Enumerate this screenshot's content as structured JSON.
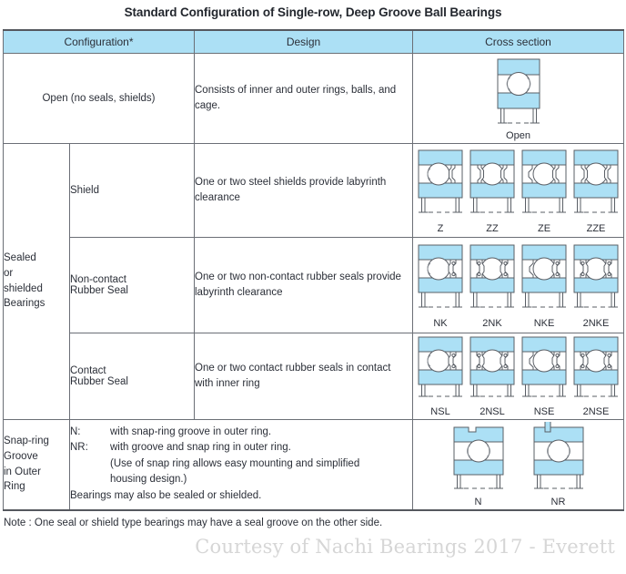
{
  "title": "Standard Configuration of Single-row, Deep Groove Ball Bearings",
  "colors": {
    "ring_blue": "#ace0f5",
    "header_blue": "#ace0f5",
    "line": "#6b6f76",
    "text": "#2b2f38",
    "watermark": "#d6d6d6"
  },
  "header": {
    "configuration": "Configuration*",
    "design": "Design",
    "cross_section": "Cross section"
  },
  "rows": {
    "open": {
      "configuration": "Open (no seals, shields)",
      "design": "Consists of inner and outer rings, balls, and cage.",
      "diagrams": [
        {
          "label": "Open",
          "type": "open"
        }
      ]
    },
    "group_label": "Sealed\nor\nshielded\nBearings",
    "group_label_lines": [
      "Sealed",
      "or",
      "shielded",
      "Bearings"
    ],
    "shield": {
      "subtype": "Shield",
      "design": "One or two steel shields provide labyrinth clearance",
      "diagrams": [
        {
          "label": "Z",
          "type": "shield",
          "sides": "right"
        },
        {
          "label": "ZZ",
          "type": "shield",
          "sides": "both"
        },
        {
          "label": "ZE",
          "type": "shield-e",
          "sides": "right"
        },
        {
          "label": "ZZE",
          "type": "shield-e",
          "sides": "both"
        }
      ]
    },
    "noncontact": {
      "subtype_lines": [
        "Non-contact",
        "Rubber Seal"
      ],
      "design": "One or two non-contact rubber seals provide labyrinth clearance",
      "diagrams": [
        {
          "label": "NK",
          "type": "seal",
          "sides": "right"
        },
        {
          "label": "2NK",
          "type": "seal",
          "sides": "both"
        },
        {
          "label": "NKE",
          "type": "seal-e",
          "sides": "right"
        },
        {
          "label": "2NKE",
          "type": "seal-e",
          "sides": "both"
        }
      ]
    },
    "contact": {
      "subtype_lines": [
        "Contact",
        "Rubber Seal"
      ],
      "design": "One or two contact rubber seals in contact with inner ring",
      "diagrams": [
        {
          "label": "NSL",
          "type": "seal",
          "sides": "right"
        },
        {
          "label": "2NSL",
          "type": "seal",
          "sides": "both"
        },
        {
          "label": "NSE",
          "type": "seal-e",
          "sides": "right"
        },
        {
          "label": "2NSE",
          "type": "seal-e",
          "sides": "both"
        }
      ]
    },
    "snapring": {
      "label_lines": [
        "Snap-ring",
        "Groove",
        "in Outer",
        "Ring"
      ],
      "n_key": "N:",
      "n_text": "with snap-ring groove in outer ring.",
      "nr_key": "NR:",
      "nr_text": "with groove and snap ring in outer ring.",
      "nr_note_1": "(Use of snap ring allows easy mounting and simplified",
      "nr_note_2": "housing design.)",
      "tail": "Bearings may also be sealed or shielded.",
      "diagrams": [
        {
          "label": "N",
          "type": "groove"
        },
        {
          "label": "NR",
          "type": "snapring"
        }
      ]
    }
  },
  "footer": {
    "note": "Note : One seal or shield type bearings may have a seal groove on the other side.",
    "watermark": "Courtesy of Nachi Bearings 2017 - Everett"
  }
}
